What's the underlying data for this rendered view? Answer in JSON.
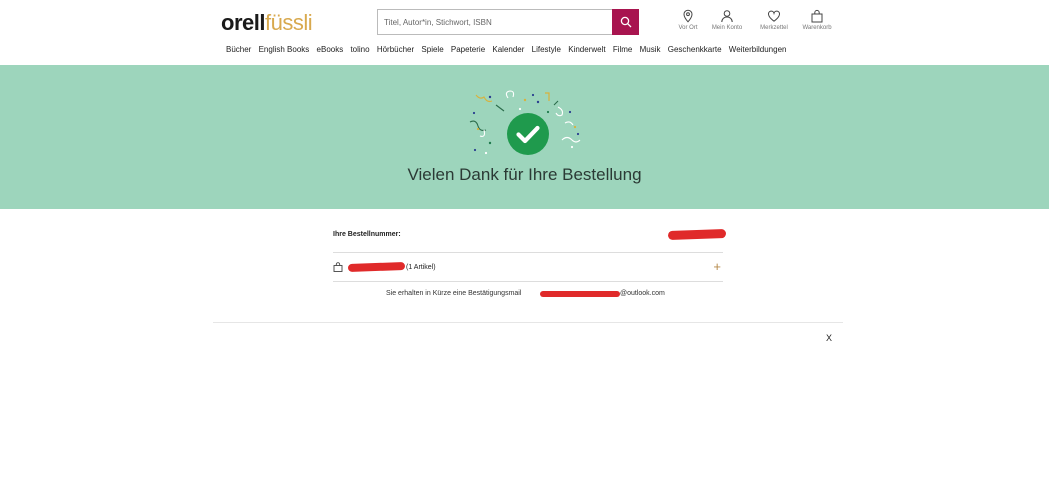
{
  "header": {
    "logo_part1": "orell",
    "logo_part2": "füssli",
    "search_placeholder": "Titel, Autor*in, Stichwort, ISBN",
    "icons": [
      {
        "name": "location-pin-icon",
        "label": "Vor Ort"
      },
      {
        "name": "user-icon",
        "label": "Mein Konto"
      },
      {
        "name": "heart-icon",
        "label": "Merkzettel"
      },
      {
        "name": "shopping-bag-icon",
        "label": "Warenkorb"
      }
    ]
  },
  "nav": [
    "Bücher",
    "English Books",
    "eBooks",
    "tolino",
    "Hörbücher",
    "Spiele",
    "Papeterie",
    "Kalender",
    "Lifestyle",
    "Kinderwelt",
    "Filme",
    "Musik",
    "Geschenkkarte",
    "Weiterbildungen"
  ],
  "hero": {
    "title": "Vielen Dank für Ihre Bestellung",
    "color": "#9dd5bc",
    "check_color": "#1f9a4d"
  },
  "order": {
    "number_label": "Ihre Bestellnummer:",
    "items_text": "(1 Artikel)",
    "expand_symbol": "+",
    "mail_prefix": "Sie erhalten in Kürze eine Bestätigungsmail",
    "mail_suffix": "@outlook.com"
  },
  "close_label": "X",
  "colors": {
    "brand_magenta": "#a8144f",
    "brand_gold": "#d8a94e",
    "redaction": "#e02a2a"
  }
}
